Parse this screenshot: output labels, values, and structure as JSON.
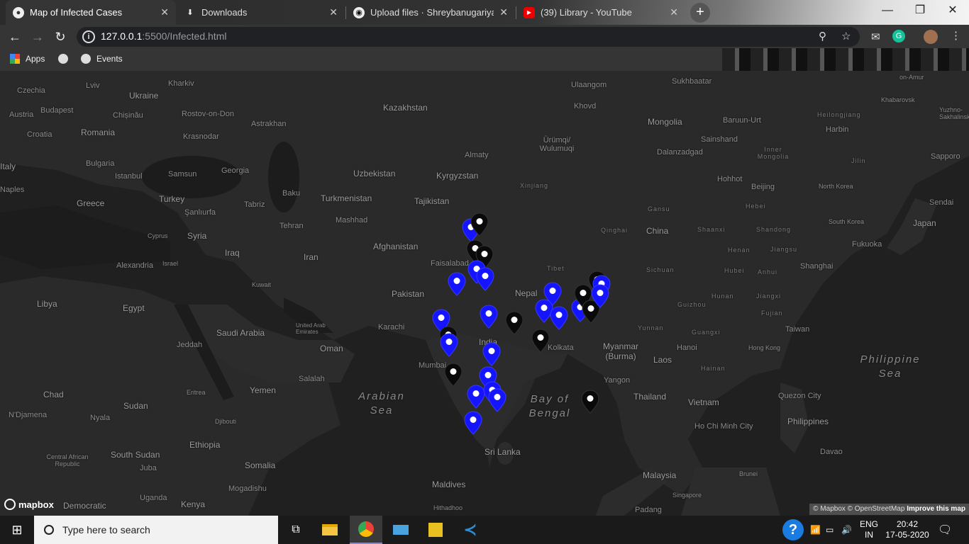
{
  "browser": {
    "tabs": [
      {
        "title": "Map of Infected Cases",
        "icon": "globe-icon",
        "active": true
      },
      {
        "title": "Downloads",
        "icon": "download-icon",
        "active": false
      },
      {
        "title": "Upload files · Shreybanugariya/Pl",
        "icon": "github-icon",
        "active": false
      },
      {
        "title": "(39) Library - YouTube",
        "icon": "youtube-icon",
        "active": false
      }
    ],
    "url_host": "127.0.0.1",
    "url_path": ":5500/Infected.html",
    "bookmarks": [
      "Apps",
      "",
      "Events"
    ]
  },
  "map": {
    "attribution": "© Mapbox © OpenStreetMap",
    "improve": "Improve this map",
    "logo_text": "mapbox",
    "labels": [
      "Czechia",
      "Lviv",
      "Kharkiv",
      "Ukraine",
      "Austria",
      "Budapest",
      "Chișinău",
      "Rostov-on-Don",
      "Croatia",
      "Romania",
      "Krasnodar",
      "Astrakhan",
      "Kazakhstan",
      "Italy",
      "Bulgaria",
      "Samsun",
      "Georgia",
      "Istanbul",
      "Naples",
      "Greece",
      "Turkey",
      "Baku",
      "Tabriz",
      "Şanlıurfa",
      "Cyprus",
      "Syria",
      "Tehran",
      "Mashhad",
      "Iraq",
      "Iran",
      "Alexandria",
      "Israel",
      "Kuwait",
      "Libya",
      "Egypt",
      "Saudi Arabia",
      "Jeddah",
      "United Arab Emirates",
      "Oman",
      "Karachi",
      "Pakistan",
      "Afghanistan",
      "Faisalabad",
      "Uzbekistan",
      "Turkmenistan",
      "Tajikistan",
      "Kyrgyzstan",
      "Almaty",
      "Ürümqi/ Wulumuqi",
      "Mongolia",
      "Khovd",
      "Ulaangom",
      "Sukhbaatar",
      "Baruun-Urt",
      "Sainshand",
      "Dalanzadgad",
      "Hohhot",
      "Beijing",
      "China",
      "Nepal",
      "Tibet",
      "India",
      "Kolkata",
      "Mumbai",
      "Salalah",
      "Yemen",
      "Eritrea",
      "Chad",
      "Sudan",
      "N'Djamena",
      "Nyala",
      "Djibouti",
      "Ethiopia",
      "Somalia",
      "South Sudan",
      "Juba",
      "Central African Republic",
      "Mogadishu",
      "Kenya",
      "Democratic",
      "Uganda",
      "Sri Lanka",
      "Maldives",
      "Hithadhoo",
      "Arabian Sea",
      "Bay of Bengal",
      "Myanmar (Burma)",
      "Laos",
      "Yangon",
      "Thailand",
      "Vietnam",
      "Ho Chi Minh City",
      "Hanoi",
      "Hong Kong",
      "Taiwan",
      "Quezon City",
      "Philippines",
      "Philippine Sea",
      "Davao",
      "Malaysia",
      "Singapore",
      "Brunei",
      "Padang",
      "Shanghai",
      "Fukuoka",
      "South Korea",
      "Japan",
      "Sendai",
      "Sapporo",
      "Harbin",
      "Khabarovsk",
      "Yuzhno-Sakhalinsk",
      "North Korea",
      "Heilongjiang",
      "Jilin",
      "Inner Mongolia",
      "Xinjiang",
      "Gansu",
      "Qinghai",
      "Sichuan",
      "Hubei",
      "Anhui",
      "Henan",
      "Jiangsu",
      "Shaanxi",
      "Shandong",
      "Hebei",
      "Hunan",
      "Jiangxi",
      "Fujian",
      "Guizhou",
      "Guangxi",
      "Yunnan",
      "Hainan",
      "on-Amur"
    ]
  },
  "taskbar": {
    "search_placeholder": "Type here to search",
    "lang": "ENG",
    "region": "IN",
    "time": "20:42",
    "date": "17-05-2020"
  }
}
